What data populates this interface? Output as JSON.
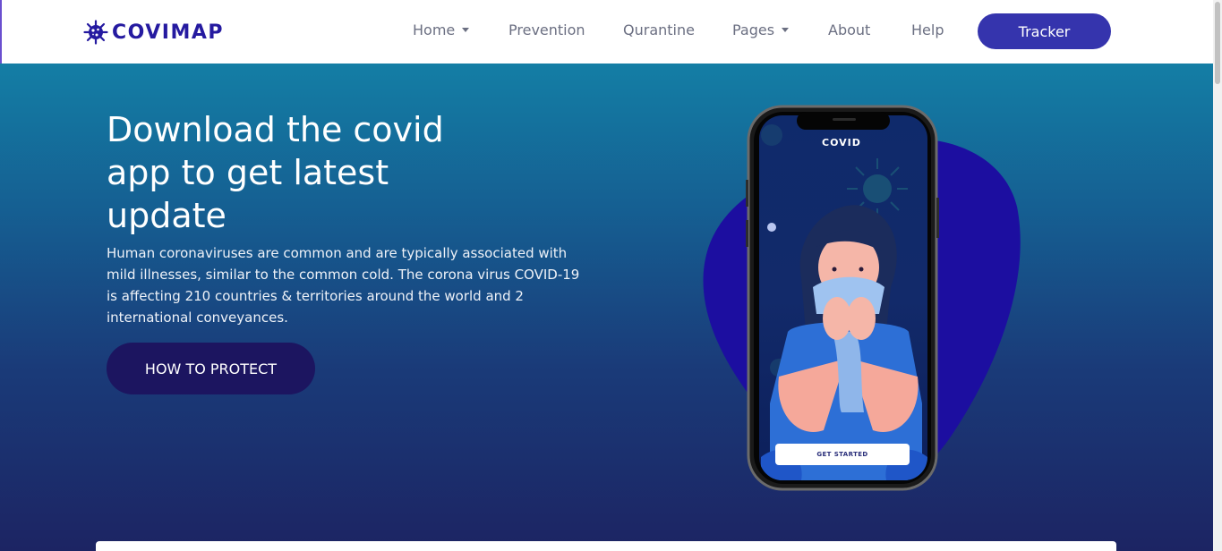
{
  "brand": {
    "name": "COVIMAP",
    "color": "#251aa0"
  },
  "nav": {
    "items": [
      {
        "label": "Home",
        "dropdown": true
      },
      {
        "label": "Prevention",
        "dropdown": false
      },
      {
        "label": "Qurantine",
        "dropdown": false
      },
      {
        "label": "Pages",
        "dropdown": true
      },
      {
        "label": "About",
        "dropdown": false
      },
      {
        "label": "Help",
        "dropdown": false
      }
    ],
    "cta_label": "Tracker"
  },
  "hero": {
    "headline_line1": "Download the covid",
    "headline_line2": "app to get latest",
    "headline_line3": "update",
    "description": "Human coronaviruses are common and are typically associated with mild illnesses, similar to the common cold. The corona virus COVID-19 is affecting 210 countries & territories around the world and 2 international conveyances.",
    "button_label": "HOW TO PROTECT"
  },
  "phone": {
    "title": "COVID",
    "button_label": "GET STARTED"
  },
  "colors": {
    "accent": "#3534ad",
    "blob": "#1c0ea0",
    "hero_top": "#147ea5",
    "hero_bottom": "#1c2463"
  },
  "icons": [
    "virus-logo-icon",
    "chevron-down-icon",
    "virus-icon"
  ]
}
